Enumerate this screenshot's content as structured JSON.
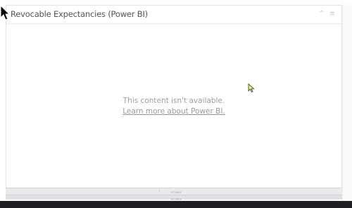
{
  "panel": {
    "title": "Revocable Expectancies (Power BI)",
    "collapse_icon": "chevron-up-icon",
    "menu_icon": "hamburger-menu-icon"
  },
  "content": {
    "message": "This content isn't available.",
    "link_text": "Learn more about Power BI."
  },
  "footer": {
    "label1": "cs adcs",
    "label2": "cs adcs"
  },
  "colors": {
    "title_text": "#555555",
    "message_text": "#a0a0a0",
    "cursor_highlight": "#e8f25c",
    "bottom_bar": "#1d1f23"
  }
}
